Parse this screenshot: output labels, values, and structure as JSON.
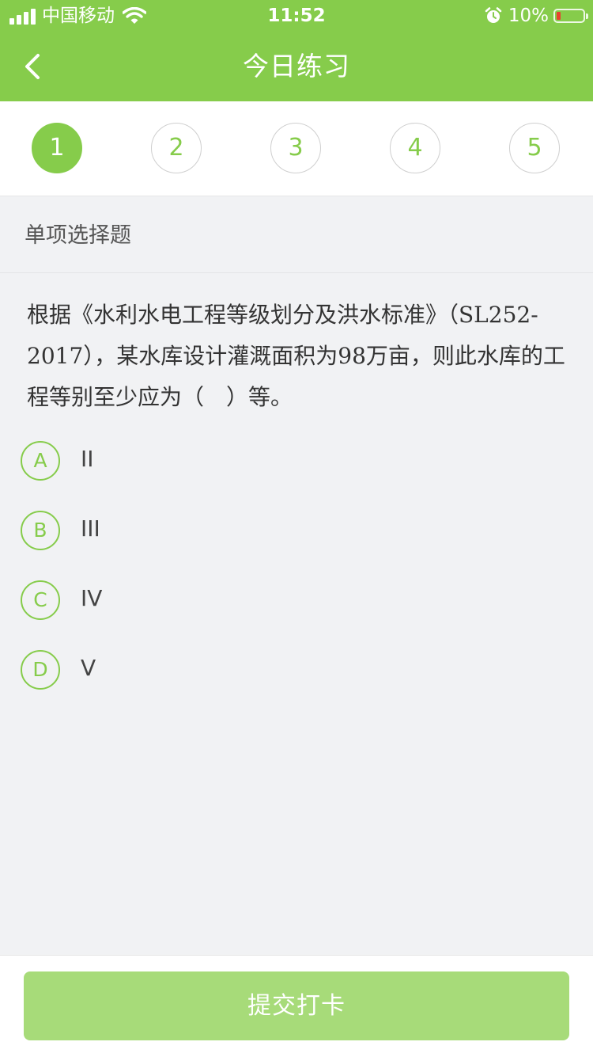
{
  "status_bar": {
    "carrier": "中国移动",
    "time": "11:52",
    "battery": "10%"
  },
  "nav": {
    "title": "今日练习"
  },
  "steps": [
    "1",
    "2",
    "3",
    "4",
    "5"
  ],
  "question": {
    "type": "单项选择题",
    "text": "根据《水利水电工程等级划分及洪水标准》（SL252-2017），某水库设计灌溉面积为98万亩，则此水库的工程等别至少应为（　）等。",
    "options": [
      {
        "letter": "A",
        "text": "II"
      },
      {
        "letter": "B",
        "text": "III"
      },
      {
        "letter": "C",
        "text": "IV"
      },
      {
        "letter": "D",
        "text": "V"
      }
    ]
  },
  "footer": {
    "submit_label": "提交打卡"
  },
  "colors": {
    "accent": "#86cc4b",
    "button_disabled": "#a7db79",
    "background": "#f1f2f4"
  },
  "icons": {
    "back": "chevron-left-icon",
    "signal": "signal-icon",
    "wifi": "wifi-icon",
    "alarm": "alarm-icon",
    "battery": "battery-icon"
  }
}
